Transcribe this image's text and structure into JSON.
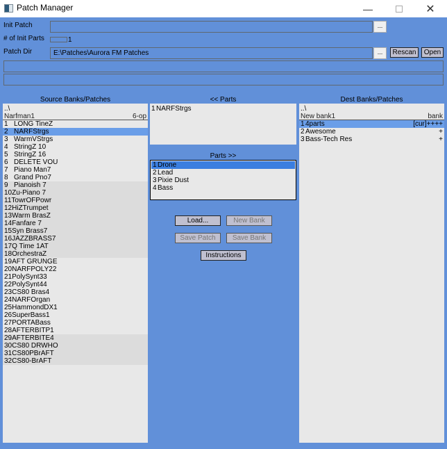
{
  "window": {
    "title": "Patch Manager",
    "minimize_glyph": "—",
    "close_glyph": "✕"
  },
  "top": {
    "init_patch_label": "Init Patch",
    "init_patch_value": "",
    "init_parts_label": "# of Init Parts",
    "init_parts_value": "1",
    "patch_dir_label": "Patch Dir",
    "patch_dir_value": "E:\\Patches\\Aurora FM Patches",
    "browse_label": "...",
    "rescan_label": "Rescan",
    "open_label": "Open",
    "status_line_1": "",
    "status_line_2": ""
  },
  "source": {
    "title": "Source Banks/Patches",
    "up_dir": "..\\",
    "bank_name": "Narfman1",
    "bank_type": "6-op",
    "patches": [
      {
        "num": "1",
        "name": "LONG TineZ"
      },
      {
        "num": "2",
        "name": "NARFStrgs"
      },
      {
        "num": "3",
        "name": "WarmVStrgs"
      },
      {
        "num": "4",
        "name": "StringZ 10"
      },
      {
        "num": "5",
        "name": "StringZ 16"
      },
      {
        "num": "6",
        "name": "DELETE VOU"
      },
      {
        "num": "7",
        "name": "Piano Man7"
      },
      {
        "num": "8",
        "name": "Grand Pno7"
      },
      {
        "num": "9",
        "name": "Pianoish 7"
      },
      {
        "num": "10",
        "name": "Zu-Piano 7"
      },
      {
        "num": "11",
        "name": "TowrOFPowr"
      },
      {
        "num": "12",
        "name": "HiZTrumpet"
      },
      {
        "num": "13",
        "name": "Warm BrasZ"
      },
      {
        "num": "14",
        "name": "Fanfare 7"
      },
      {
        "num": "15",
        "name": "Syn Brass7"
      },
      {
        "num": "16",
        "name": "JAZZBRASS7"
      },
      {
        "num": "17",
        "name": "Q Time 1AT"
      },
      {
        "num": "18",
        "name": "OrchestraZ"
      },
      {
        "num": "19",
        "name": "AFT GRUNGE"
      },
      {
        "num": "20",
        "name": "NARFPOLY22"
      },
      {
        "num": "21",
        "name": "PolySynt33"
      },
      {
        "num": "22",
        "name": "PolySynt44"
      },
      {
        "num": "23",
        "name": "CS80 Bras4"
      },
      {
        "num": "24",
        "name": "NARFOrgan"
      },
      {
        "num": "25",
        "name": "HammondDX1"
      },
      {
        "num": "26",
        "name": "SuperBass1"
      },
      {
        "num": "27",
        "name": "PORTABass"
      },
      {
        "num": "28",
        "name": "AFTERBITP1"
      },
      {
        "num": "29",
        "name": "AFTERBITE4"
      },
      {
        "num": "30",
        "name": "CS80 DRWHO"
      },
      {
        "num": "31",
        "name": "CS80PBrAFT"
      },
      {
        "num": "32",
        "name": "CS80-BrAFT"
      }
    ]
  },
  "parts_in": {
    "title": "<< Parts",
    "items": [
      {
        "num": "1",
        "name": "NARFStrgs"
      }
    ]
  },
  "parts_out": {
    "title": "Parts >>",
    "items": [
      {
        "num": "1",
        "name": "Drone"
      },
      {
        "num": "2",
        "name": "Lead"
      },
      {
        "num": "3",
        "name": "Pixie Dust"
      },
      {
        "num": "4",
        "name": "Bass"
      }
    ]
  },
  "actions": {
    "load": "Load...",
    "new_bank": "New Bank",
    "save_patch": "Save Patch",
    "save_bank": "Save Bank",
    "instructions": "Instructions"
  },
  "dest": {
    "title": "Dest Banks/Patches",
    "up_dir": "..\\",
    "bank_name": "New bank1",
    "bank_type": "bank",
    "patches": [
      {
        "num": "1",
        "name": "4parts",
        "flag": "[cur]++++"
      },
      {
        "num": "2",
        "name": "Awesome",
        "flag": "+"
      },
      {
        "num": "3",
        "name": "Bass-Tech Res",
        "flag": "+"
      }
    ]
  },
  "colors": {
    "background": "#6190d9",
    "panel": "#e8e8e8",
    "selection": "#6a9ee8",
    "part_selection": "#3a7ee0"
  }
}
